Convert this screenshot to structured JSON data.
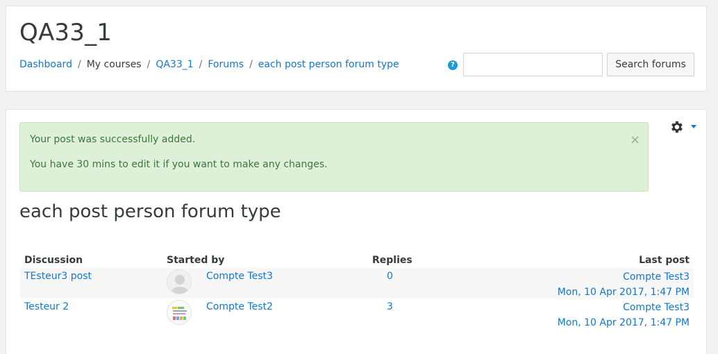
{
  "header": {
    "title": "QA33_1",
    "breadcrumb": [
      "Dashboard",
      "My courses",
      "QA33_1",
      "Forums",
      "each post person forum type"
    ],
    "search_placeholder": "",
    "search_button": "Search forums",
    "help_glyph": "?"
  },
  "alert": {
    "line1": "Your post was successfully added.",
    "line2": "You have 30 mins to edit it if you want to make any changes.",
    "close": "×"
  },
  "forum": {
    "title": "each post person forum type",
    "columns": {
      "discussion": "Discussion",
      "started_by": "Started by",
      "replies": "Replies",
      "last_post": "Last post"
    },
    "rows": [
      {
        "discussion": "TEsteur3 post",
        "started_by": "Compte Test3",
        "replies": "0",
        "last_author": "Compte Test3",
        "last_date": "Mon, 10 Apr 2017, 1:47 PM",
        "avatar": "default-user-avatar"
      },
      {
        "discussion": "Testeur 2",
        "started_by": "Compte Test2",
        "replies": "3",
        "last_author": "Compte Test3",
        "last_date": "Mon, 10 Apr 2017, 1:47 PM",
        "avatar": "picture-avatar"
      }
    ]
  },
  "icons": {
    "settings": "gear-icon",
    "help": "question-circle-icon"
  },
  "colors": {
    "link": "#1177d1",
    "alert_bg": "#dff0d8",
    "alert_text": "#3c763d"
  }
}
